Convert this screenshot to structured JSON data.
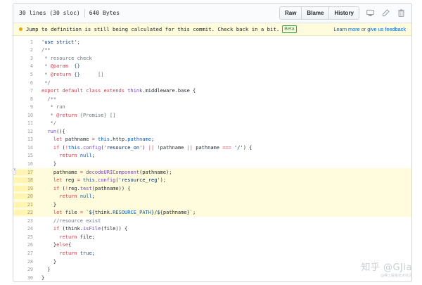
{
  "file_header": {
    "lines_info": "30 lines (30 sloc)",
    "size": "640 Bytes",
    "buttons": [
      "Raw",
      "Blame",
      "History"
    ],
    "icons": [
      "desktop-icon",
      "pencil-icon",
      "trash-icon"
    ]
  },
  "notice": {
    "text": "Jump to definition is still being calculated for this commit. Check back in a bit.",
    "badge": "Beta",
    "link1": "Learn more",
    "or": " or ",
    "link2": "give us feedback"
  },
  "highlight_range": [
    17,
    22
  ],
  "code_lines": [
    {
      "n": "1",
      "tokens": [
        [
          "str",
          "'use strict'"
        ],
        [
          "",
          ";"
        ]
      ]
    },
    {
      "n": "2",
      "tokens": [
        [
          "cm",
          "/**"
        ]
      ]
    },
    {
      "n": "3",
      "tokens": [
        [
          "cm",
          " * resource check"
        ]
      ]
    },
    {
      "n": "4",
      "tokens": [
        [
          "cm",
          " * "
        ],
        [
          "kw",
          "@param"
        ],
        [
          "cm",
          "  "
        ],
        [
          "cst",
          "{}"
        ]
      ]
    },
    {
      "n": "5",
      "tokens": [
        [
          "cm",
          " * "
        ],
        [
          "kw",
          "@return"
        ],
        [
          "cm",
          " "
        ],
        [
          "cst",
          "{}"
        ],
        [
          "cm",
          "      []"
        ]
      ]
    },
    {
      "n": "6",
      "tokens": [
        [
          "cm",
          " */"
        ]
      ]
    },
    {
      "n": "7",
      "tokens": [
        [
          "kw",
          "export"
        ],
        [
          "",
          " "
        ],
        [
          "kw",
          "default"
        ],
        [
          "",
          " "
        ],
        [
          "kw",
          "class"
        ],
        [
          "",
          " "
        ],
        [
          "kw",
          "extends"
        ],
        [
          "",
          " "
        ],
        [
          "fn",
          "think"
        ],
        [
          "",
          ".middleware.base {"
        ]
      ]
    },
    {
      "n": "8",
      "tokens": [
        [
          "cm",
          "  /**"
        ]
      ]
    },
    {
      "n": "9",
      "tokens": [
        [
          "cm",
          "   * run"
        ]
      ]
    },
    {
      "n": "10",
      "tokens": [
        [
          "cm",
          "   * "
        ],
        [
          "kw",
          "@return"
        ],
        [
          "cm",
          " {Promise} []"
        ]
      ]
    },
    {
      "n": "11",
      "tokens": [
        [
          "cm",
          "   */"
        ]
      ]
    },
    {
      "n": "12",
      "tokens": [
        [
          "",
          "  "
        ],
        [
          "fn",
          "run"
        ],
        [
          "",
          "(){"
        ]
      ]
    },
    {
      "n": "13",
      "tokens": [
        [
          "",
          "    "
        ],
        [
          "kw",
          "let"
        ],
        [
          "",
          " pathname "
        ],
        [
          "kw",
          "="
        ],
        [
          "",
          " "
        ],
        [
          "cst",
          "this"
        ],
        [
          "",
          ".http."
        ],
        [
          "cst",
          "pathname"
        ],
        [
          "",
          ";"
        ]
      ]
    },
    {
      "n": "14",
      "tokens": [
        [
          "",
          "    "
        ],
        [
          "kw",
          "if"
        ],
        [
          "",
          " ("
        ],
        [
          "kw",
          "!"
        ],
        [
          "cst",
          "this"
        ],
        [
          "",
          "."
        ],
        [
          "fn",
          "config"
        ],
        [
          "",
          "("
        ],
        [
          "str",
          "'resource_on'"
        ],
        [
          "",
          ") "
        ],
        [
          "kw",
          "||"
        ],
        [
          "",
          " "
        ],
        [
          "kw",
          "!"
        ],
        [
          "",
          "pathname "
        ],
        [
          "kw",
          "||"
        ],
        [
          "",
          " pathname "
        ],
        [
          "kw",
          "==="
        ],
        [
          "",
          " "
        ],
        [
          "str",
          "'/'"
        ],
        [
          "",
          ") {"
        ]
      ]
    },
    {
      "n": "15",
      "tokens": [
        [
          "",
          "      "
        ],
        [
          "kw",
          "return"
        ],
        [
          "",
          " "
        ],
        [
          "cst",
          "null"
        ],
        [
          "",
          ";"
        ]
      ]
    },
    {
      "n": "16",
      "tokens": [
        [
          "",
          "    }"
        ]
      ]
    },
    {
      "n": "17",
      "tokens": [
        [
          "",
          "    pathname "
        ],
        [
          "kw",
          "="
        ],
        [
          "",
          " "
        ],
        [
          "fn",
          "decodeURIComponent"
        ],
        [
          "",
          "(pathname);"
        ]
      ]
    },
    {
      "n": "18",
      "tokens": [
        [
          "",
          "    "
        ],
        [
          "kw",
          "let"
        ],
        [
          "",
          " reg "
        ],
        [
          "kw",
          "="
        ],
        [
          "",
          " "
        ],
        [
          "cst",
          "this"
        ],
        [
          "",
          "."
        ],
        [
          "fn",
          "config"
        ],
        [
          "",
          "("
        ],
        [
          "str",
          "'resource_reg'"
        ],
        [
          "",
          ");"
        ]
      ]
    },
    {
      "n": "19",
      "tokens": [
        [
          "",
          "    "
        ],
        [
          "kw",
          "if"
        ],
        [
          "",
          " ("
        ],
        [
          "kw",
          "!"
        ],
        [
          "",
          "reg."
        ],
        [
          "fn",
          "test"
        ],
        [
          "",
          "(pathname)) {"
        ]
      ]
    },
    {
      "n": "20",
      "tokens": [
        [
          "",
          "      "
        ],
        [
          "kw",
          "return"
        ],
        [
          "",
          " "
        ],
        [
          "cst",
          "null"
        ],
        [
          "",
          ";"
        ]
      ]
    },
    {
      "n": "21",
      "tokens": [
        [
          "",
          "    }"
        ]
      ]
    },
    {
      "n": "22",
      "tokens": [
        [
          "",
          "    "
        ],
        [
          "kw",
          "let"
        ],
        [
          "",
          " file "
        ],
        [
          "kw",
          "="
        ],
        [
          "",
          " "
        ],
        [
          "str",
          "`${"
        ],
        [
          "",
          "think."
        ],
        [
          "cst",
          "RESOURCE_PATH"
        ],
        [
          "str",
          "}/${"
        ],
        [
          "",
          "pathname"
        ],
        [
          "str",
          "}`"
        ],
        [
          "",
          ";"
        ]
      ]
    },
    {
      "n": "23",
      "tokens": [
        [
          "cm",
          "    //resource exist"
        ]
      ]
    },
    {
      "n": "24",
      "tokens": [
        [
          "",
          "    "
        ],
        [
          "kw",
          "if"
        ],
        [
          "",
          " (think."
        ],
        [
          "fn",
          "isFile"
        ],
        [
          "",
          "(file)) {"
        ]
      ]
    },
    {
      "n": "25",
      "tokens": [
        [
          "",
          "      "
        ],
        [
          "kw",
          "return"
        ],
        [
          "",
          " file;"
        ]
      ]
    },
    {
      "n": "26",
      "tokens": [
        [
          "",
          "    }"
        ],
        [
          "kw",
          "else"
        ],
        [
          "",
          "{"
        ]
      ]
    },
    {
      "n": "27",
      "tokens": [
        [
          "",
          "      "
        ],
        [
          "kw",
          "return"
        ],
        [
          "",
          " "
        ],
        [
          "cst",
          "true"
        ],
        [
          "",
          ";"
        ]
      ]
    },
    {
      "n": "28",
      "tokens": [
        [
          "",
          "    }"
        ]
      ]
    },
    {
      "n": "29",
      "tokens": [
        [
          "",
          "  }"
        ]
      ]
    },
    {
      "n": "30",
      "tokens": [
        [
          "",
          "}"
        ]
      ]
    }
  ],
  "line_menu_label": "···",
  "watermark": {
    "main": "知乎 @GJia",
    "sub": "@稀土掘金技术社区"
  }
}
